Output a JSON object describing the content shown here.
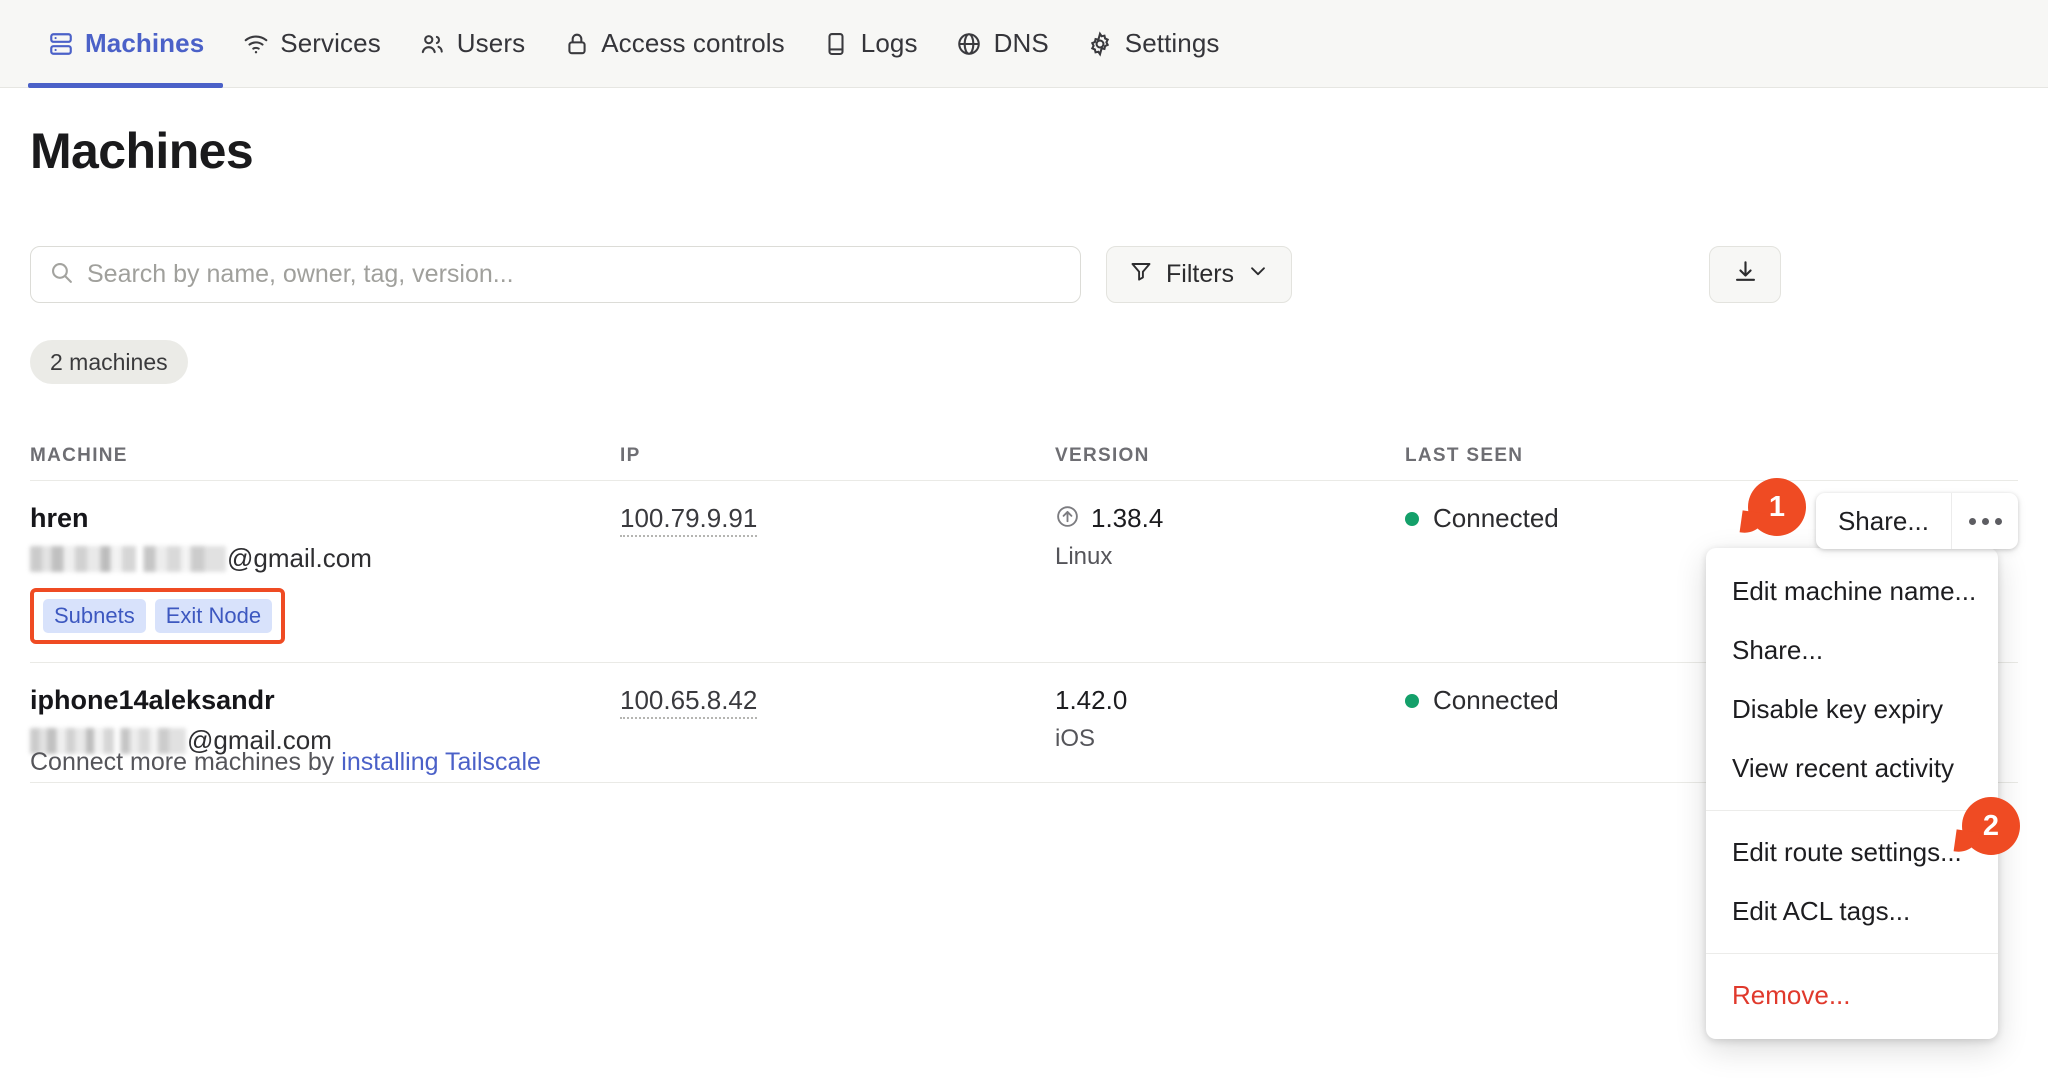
{
  "nav": {
    "items": [
      {
        "label": "Machines",
        "icon": "server-icon",
        "active": true
      },
      {
        "label": "Services",
        "icon": "wifi-icon",
        "active": false
      },
      {
        "label": "Users",
        "icon": "users-icon",
        "active": false
      },
      {
        "label": "Access controls",
        "icon": "lock-icon",
        "active": false
      },
      {
        "label": "Logs",
        "icon": "document-icon",
        "active": false
      },
      {
        "label": "DNS",
        "icon": "globe-icon",
        "active": false
      },
      {
        "label": "Settings",
        "icon": "gear-icon",
        "active": false
      }
    ]
  },
  "page": {
    "title": "Machines"
  },
  "toolbar": {
    "search_placeholder": "Search by name, owner, tag, version...",
    "search_value": "",
    "search_icon": "search-icon",
    "filters_label": "Filters",
    "filters_icon": "funnel-icon",
    "filters_chevron": "chevron-down-icon",
    "download_icon": "download-icon"
  },
  "count_pill": {
    "label": "2 machines"
  },
  "table": {
    "headers": [
      "MACHINE",
      "IP",
      "VERSION",
      "LAST SEEN"
    ],
    "rows": [
      {
        "name": "hren",
        "owner_domain": "@gmail.com",
        "owner_masked": true,
        "tags": [
          "Subnets",
          "Exit Node"
        ],
        "ip": "100.79.9.91",
        "version": "1.38.4",
        "os": "Linux",
        "version_update_icon": "arrow-up-circle-icon",
        "status": "Connected",
        "status_color": "#14a06a",
        "share_label": "Share...",
        "more_icon": "ellipsis-icon"
      },
      {
        "name": "iphone14aleksandr",
        "owner_domain": "@gmail.com",
        "owner_masked": true,
        "tags": [],
        "ip": "100.65.8.42",
        "version": "1.42.0",
        "os": "iOS",
        "version_update_icon": "",
        "status": "Connected",
        "status_color": "#14a06a",
        "share_label": "",
        "more_icon": ""
      }
    ]
  },
  "menu": {
    "items": [
      {
        "label": "Edit machine name...",
        "danger": false
      },
      {
        "label": "Share...",
        "danger": false
      },
      {
        "label": "Disable key expiry",
        "danger": false
      },
      {
        "label": "View recent activity",
        "danger": false
      },
      {
        "label": "Edit route settings...",
        "danger": false
      },
      {
        "label": "Edit ACL tags...",
        "danger": false
      },
      {
        "label": "Remove...",
        "danger": true
      }
    ]
  },
  "markers": [
    {
      "number": "1"
    },
    {
      "number": "2"
    }
  ],
  "footer": {
    "text": "Connect more machines by",
    "link": "installing Tailscale"
  },
  "colors": {
    "accent_blue": "#4b61c8",
    "marker_orange": "#ef4b23",
    "highlight_border": "#ef4b23",
    "tag_bg": "#d8e2fb",
    "tag_text": "#3d58c0",
    "status_green": "#14a06a",
    "danger_red": "#e0392c"
  }
}
